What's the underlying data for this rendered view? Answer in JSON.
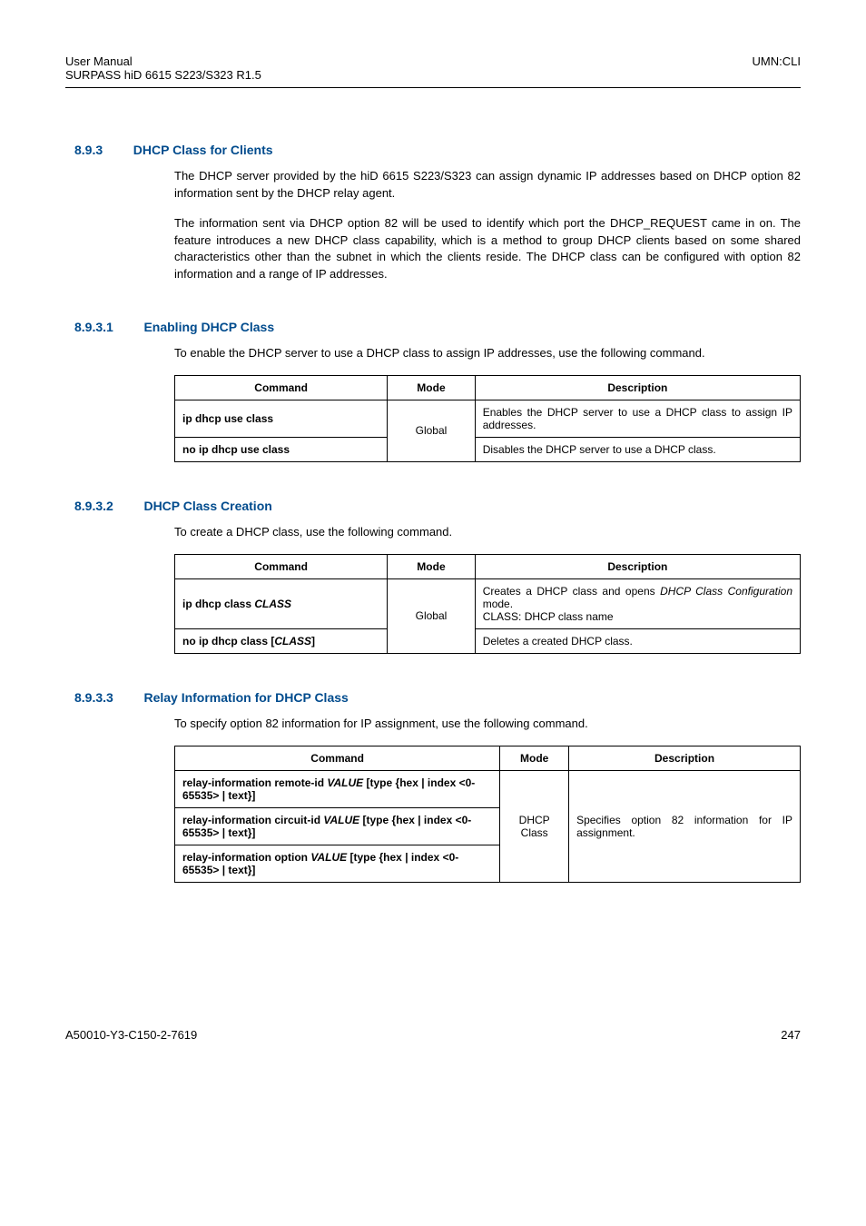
{
  "header": {
    "left_line1": "User  Manual",
    "left_line2": "SURPASS hiD 6615 S223/S323 R1.5",
    "right": "UMN:CLI"
  },
  "sec1": {
    "num": "8.9.3",
    "title": "DHCP Class for Clients",
    "p1": "The DHCP server provided by the hiD 6615 S223/S323 can assign dynamic IP addresses based on DHCP option 82 information sent by the DHCP relay agent.",
    "p2": "The information sent via DHCP option 82 will be used to identify which port the DHCP_REQUEST came in on. The feature introduces a new DHCP class capability, which is a method to group DHCP clients based on some shared characteristics other than the subnet in which the clients reside. The DHCP class can be configured with option 82 information and a range of IP addresses."
  },
  "sub1": {
    "num": "8.9.3.1",
    "title": "Enabling DHCP Class",
    "p1": "To enable the DHCP server to use a DHCP class to assign IP addresses, use the following command."
  },
  "tbl_headers": {
    "c1": "Command",
    "c2": "Mode",
    "c3": "Description"
  },
  "t1": {
    "r1c1": "ip dhcp use class",
    "mode": "Global",
    "r1c3": "Enables the DHCP server to use a DHCP class to assign IP addresses.",
    "r2c1": "no ip dhcp use class",
    "r2c3": "Disables the DHCP server to use a DHCP class."
  },
  "sub2": {
    "num": "8.9.3.2",
    "title": "DHCP Class Creation",
    "p1": "To create a DHCP class, use the following command."
  },
  "t2": {
    "r1c1_a": "ip dhcp class ",
    "r1c1_b": "CLASS",
    "mode": "Global",
    "r1c3_a": "Creates a DHCP class and opens ",
    "r1c3_b": "DHCP Class Configuration",
    "r1c3_c": " mode.",
    "r1c3_d": "CLASS: DHCP class name",
    "r2c1_a": "no ip dhcp class ",
    "r2c1_b": "[",
    "r2c1_c": "CLASS",
    "r2c1_d": "]",
    "r2c3": "Deletes a created DHCP class."
  },
  "sub3": {
    "num": "8.9.3.3",
    "title": "Relay Information for DHCP Class",
    "p1": "To specify option 82 information for IP assignment, use the following command."
  },
  "t3": {
    "mode": "DHCP Class",
    "desc": "Specifies option 82 information for IP assignment.",
    "r1": {
      "a": "relay-information  remote-id  ",
      "b": "VALUE",
      "c": "  [",
      "d": "type",
      "e": "  {",
      "f": "hex",
      "g": "  |  ",
      "h": "index",
      "i": "  <0-65535>  |  ",
      "j": "text",
      "k": "}]"
    },
    "r2": {
      "a": "relay-information  circuit-id  ",
      "b": "VALUE",
      "c": "  [",
      "d": "type",
      "e": "  {",
      "f": "hex",
      "g": "  |  ",
      "h": "index",
      "i": "  <0-65535>  |  ",
      "j": "text",
      "k": "}]"
    },
    "r3": {
      "a": "relay-information  option  ",
      "b": "VALUE",
      "c": "  [",
      "d": "type",
      "e": "  {",
      "f": "hex",
      "g": "  |  ",
      "h": "index",
      "i": "  <0-65535>  |  ",
      "j": "text",
      "k": "}]"
    }
  },
  "footer": {
    "left": "A50010-Y3-C150-2-7619",
    "right": "247"
  }
}
